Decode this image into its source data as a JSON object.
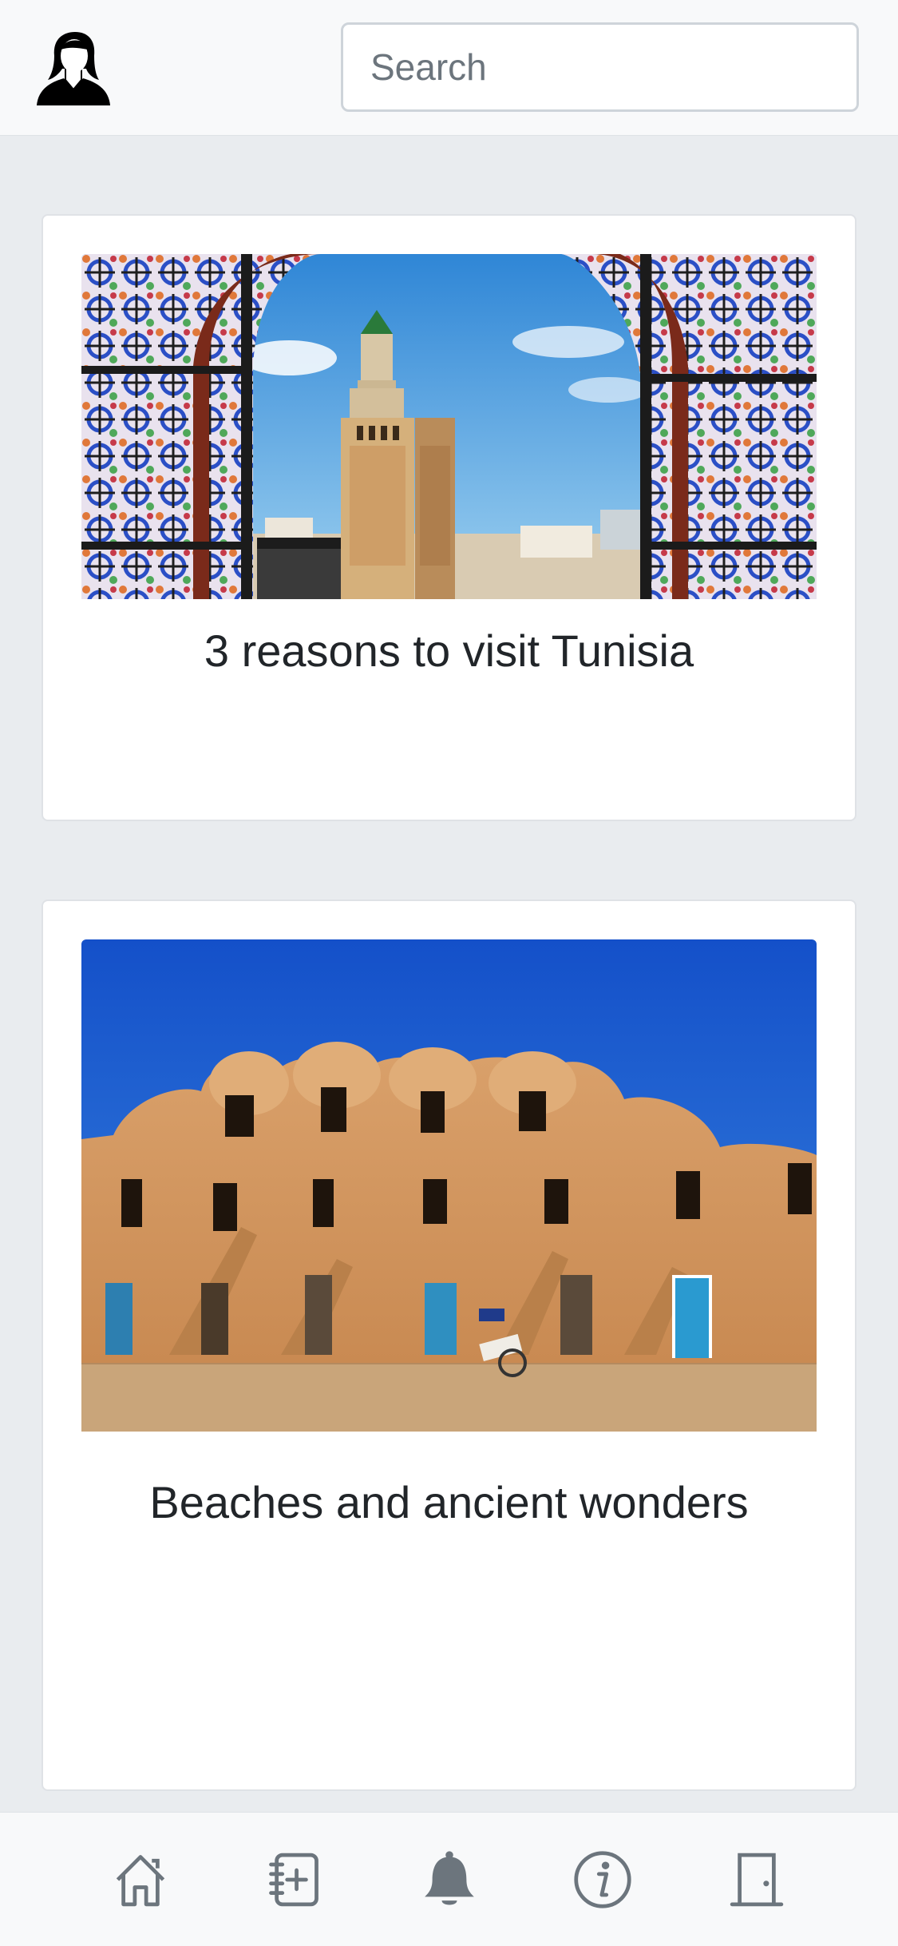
{
  "header": {
    "avatar_icon": "user-avatar-icon",
    "search": {
      "placeholder": "Search",
      "value": ""
    }
  },
  "cards": [
    {
      "title": "3 reasons to visit Tunisia",
      "image": "mosque-minaret-through-tiled-arch-photo"
    },
    {
      "title": "Beaches and ancient wonders",
      "image": "ksar-granary-building-photo"
    }
  ],
  "bottom_nav": {
    "items": [
      {
        "icon": "home-icon"
      },
      {
        "icon": "add-entry-icon"
      },
      {
        "icon": "bell-icon"
      },
      {
        "icon": "info-icon"
      },
      {
        "icon": "door-icon"
      }
    ]
  },
  "colors": {
    "page_background": "#e9ecef",
    "bar_background": "#f8f9fa",
    "card_background": "#ffffff",
    "text": "#212529",
    "icon": "#6c757d"
  }
}
